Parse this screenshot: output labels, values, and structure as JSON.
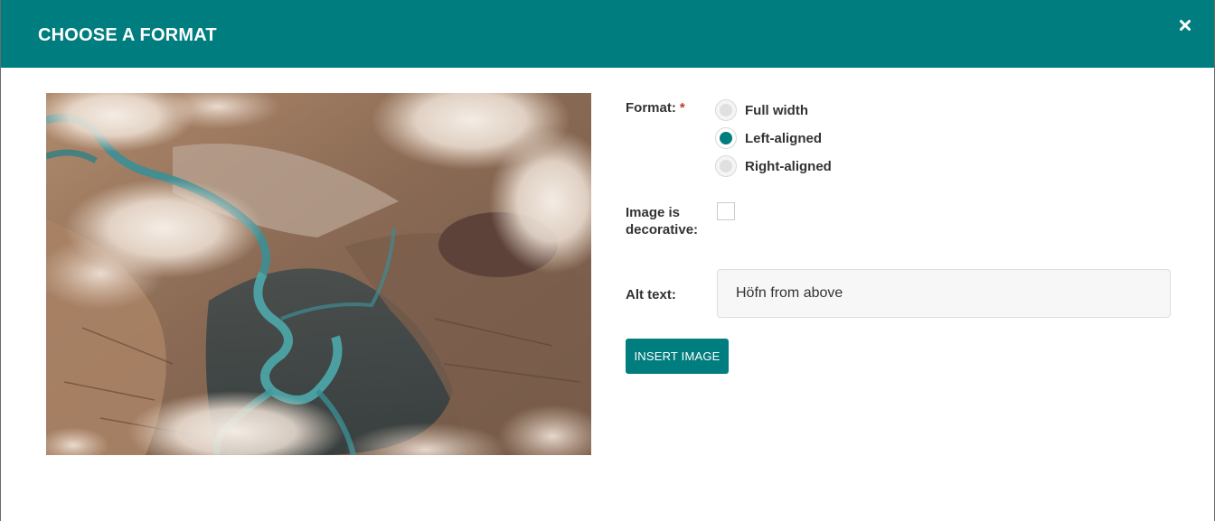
{
  "dialog": {
    "title": "CHOOSE A FORMAT",
    "close_icon": "close-icon",
    "accent_color": "#007d7e"
  },
  "preview": {
    "subject": "aerial-river-landscape"
  },
  "format": {
    "label": "Format:",
    "required_marker": "*",
    "options": [
      {
        "label": "Full width",
        "checked": false
      },
      {
        "label": "Left-aligned",
        "checked": true
      },
      {
        "label": "Right-aligned",
        "checked": false
      }
    ]
  },
  "decorative": {
    "label_line1": "Image is",
    "label_line2": "decorative:",
    "checked": false
  },
  "alt_text": {
    "label": "Alt text:",
    "value": "Höfn from above"
  },
  "actions": {
    "insert_label": "INSERT IMAGE"
  }
}
